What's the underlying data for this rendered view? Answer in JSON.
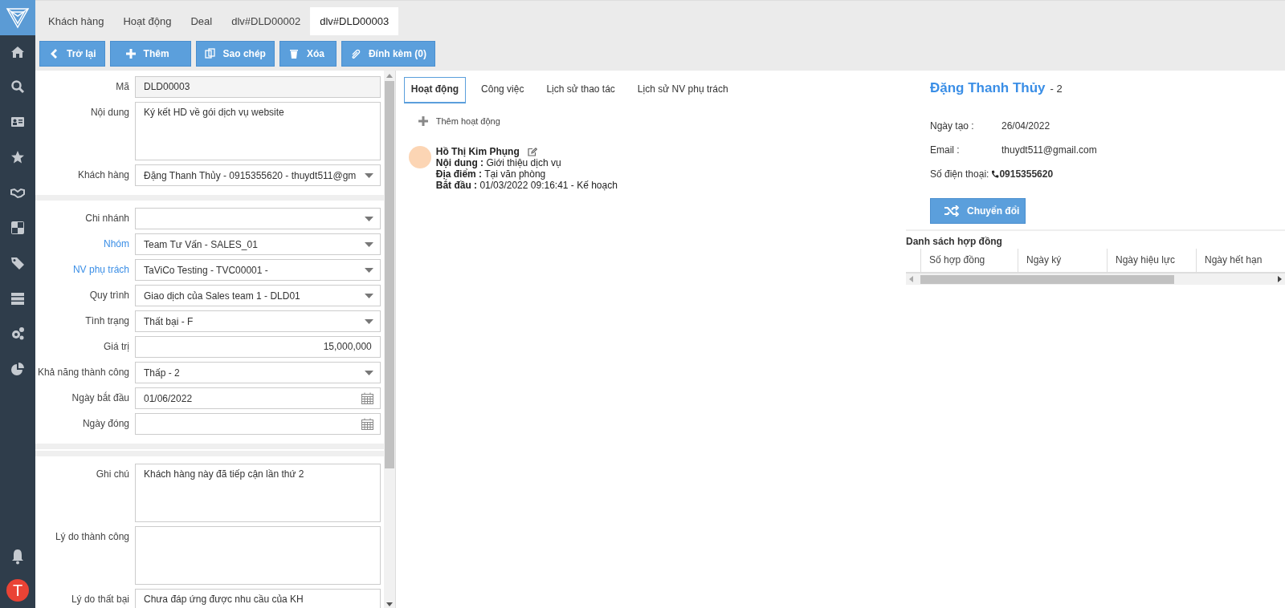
{
  "tabs": [
    {
      "label": "Khách hàng",
      "selected": false
    },
    {
      "label": "Hoạt động",
      "selected": false
    },
    {
      "label": "Deal",
      "selected": false
    },
    {
      "label": "dlv#DLD00002",
      "selected": false
    },
    {
      "label": "dlv#DLD00003",
      "selected": true
    }
  ],
  "toolbar": [
    {
      "label": "Trở lại",
      "kind": "back"
    },
    {
      "label": "Thêm",
      "kind": "add"
    },
    {
      "label": "Sao chép",
      "kind": "copy"
    },
    {
      "label": "Xóa",
      "kind": "delete"
    },
    {
      "label": "Đính kèm (0)",
      "kind": "attach"
    }
  ],
  "form": {
    "sections": [
      {
        "fields": [
          {
            "label": "Mã",
            "kind": "readonly",
            "value": "DLD00003",
            "highlighted": false
          },
          {
            "label": "Nội dung",
            "kind": "textarea",
            "value": "Ký kết HD về gói dịch vụ website",
            "highlighted": false
          },
          {
            "label": "Khách hàng",
            "kind": "select",
            "value": "Đặng Thanh Thủy - 0915355620 - thuydt511@gm",
            "highlighted": false
          }
        ]
      },
      {
        "fields": [
          {
            "label": "Chi nhánh",
            "kind": "select",
            "highlighted": false
          },
          {
            "label": "Nhóm",
            "kind": "select",
            "value": "Team Tư Vấn - SALES_01",
            "highlighted": true
          },
          {
            "label": "NV phụ trách",
            "kind": "select",
            "value": "TaViCo Testing - TVC00001 -",
            "highlighted": true
          },
          {
            "label": "Quy trình",
            "kind": "select",
            "value": "Giao dịch của Sales team 1 - DLD01",
            "highlighted": false
          },
          {
            "label": "Tình trạng",
            "kind": "select",
            "value": "Thất bại - F",
            "highlighted": false
          },
          {
            "label": "Giá trị",
            "kind": "number",
            "value": "15,000,000",
            "highlighted": false
          },
          {
            "label": "Khả năng thành công",
            "kind": "select",
            "value": "Thấp - 2",
            "highlighted": false
          },
          {
            "label": "Ngày bắt đầu",
            "kind": "date",
            "value": "01/06/2022",
            "highlighted": false
          },
          {
            "label": "Ngày đóng",
            "kind": "date",
            "highlighted": false
          }
        ]
      },
      {
        "fields": [
          {
            "label": "Ghi chú",
            "kind": "textarea",
            "value": "Khách hàng này đã tiếp cận lần thứ 2",
            "highlighted": false
          },
          {
            "label": "Lý do thành công",
            "kind": "textarea",
            "highlighted": false
          },
          {
            "label": "Lý do thất bại",
            "kind": "textarea",
            "value": "Chưa đáp ứng được nhu cầu của KH",
            "highlighted": false
          }
        ]
      }
    ]
  },
  "activity_panel": {
    "tabs": [
      {
        "label": "Hoạt động",
        "selected": true
      },
      {
        "label": "Công việc",
        "selected": false
      },
      {
        "label": "Lịch sử thao tác",
        "selected": false
      },
      {
        "label": "Lịch sử NV phụ trách",
        "selected": false
      }
    ],
    "add_label": "Thêm hoạt động",
    "activities": [
      {
        "name": "Hồ Thị Kim Phụng",
        "lines": [
          {
            "label": "Nội dung :",
            "value": "Giới thiệu dịch vụ"
          },
          {
            "label": "Địa điểm :",
            "value": "Tại văn phòng"
          },
          {
            "label": "Bắt đầu :",
            "value": "01/03/2022 09:16:41 - Kế hoạch"
          }
        ]
      }
    ]
  },
  "customer": {
    "name": "Đặng Thanh Thủy",
    "suffix": "- 2",
    "info": [
      {
        "label": "Ngày tạo :",
        "value": "26/04/2022",
        "kind": "text"
      },
      {
        "label": "Email :",
        "value": "thuydt511@gmail.com",
        "kind": "text"
      },
      {
        "label": "Số điện thoại:",
        "value": "0915355620",
        "kind": "phone"
      }
    ],
    "convert_button": "Chuyển đổi",
    "contracts": {
      "title": "Danh sách hợp đồng",
      "columns": [
        "Số hợp đồng",
        "Ngày ký",
        "Ngày hiệu lực",
        "Ngày hết hạn"
      ]
    }
  },
  "user": {
    "initial": "T"
  }
}
